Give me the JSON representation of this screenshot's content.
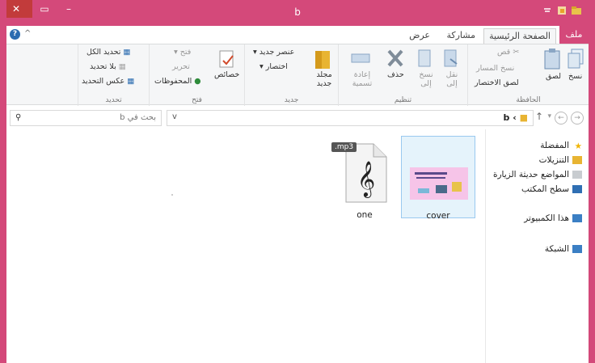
{
  "window": {
    "title": "b"
  },
  "tabs": {
    "file": "ملف",
    "home": "الصفحة الرئيسية",
    "share": "مشاركة",
    "view": "عرض"
  },
  "ribbon": {
    "clipboard": {
      "label": "الحافظة",
      "copy": "نسخ",
      "paste": "لصق",
      "cut": "قص",
      "copy_path": "نسخ المسار",
      "paste_shortcut": "لصق الاختصار"
    },
    "organize": {
      "label": "تنظيم",
      "move_to": "نقل إلى",
      "copy_to": "نسخ إلى",
      "delete": "حذف",
      "rename": "إعادة تسمية"
    },
    "new": {
      "label": "جديد",
      "new_folder": "مجلد جديد",
      "new_item": "عنصر جديد",
      "easy_access": "اختصار"
    },
    "open": {
      "label": "فتح",
      "properties": "خصائص",
      "open": "فتح",
      "edit": "تحرير",
      "history": "المحفوظات"
    },
    "select": {
      "label": "تحديد",
      "select_all": "تحديد الكل",
      "select_none": "بلا تحديد",
      "invert": "عكس التحديد"
    }
  },
  "address": {
    "path": "b",
    "search_placeholder": "بحث في b"
  },
  "navpane": {
    "favorites": "المفضلة",
    "downloads": "التنزيلات",
    "recent": "المواضع حديثة الزيارة",
    "desktop": "سطح المكتب",
    "computer": "هذا الكمبيوتر",
    "network": "الشبكة"
  },
  "files": [
    {
      "name": "cover",
      "type": "image"
    },
    {
      "name": "one",
      "type": "mp3",
      "badge": ".mp3"
    }
  ]
}
